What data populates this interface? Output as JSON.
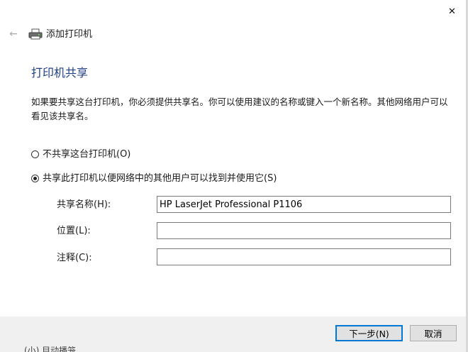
{
  "window": {
    "close_glyph": "✕",
    "back_glyph": "←",
    "wizard_title": "添加打印机",
    "wizard_icon": "printer-icon"
  },
  "page": {
    "title": "打印机共享",
    "description": "如果要共享这台打印机，你必须提供共享名。你可以使用建议的名称或键入一个新名称。其他网络用户可以看见该共享名。"
  },
  "options": {
    "no_share": {
      "label": "不共享这台打印机(O)",
      "checked": false
    },
    "share": {
      "label": "共享此打印机以便网络中的其他用户可以找到并使用它(S)",
      "checked": true
    }
  },
  "fields": {
    "share_name": {
      "label": "共享名称(H):",
      "value": "HP LaserJet Professional P1106"
    },
    "location": {
      "label": "位置(L):",
      "value": ""
    },
    "comment": {
      "label": "注释(C):",
      "value": ""
    }
  },
  "buttons": {
    "next": "下一步(N)",
    "cancel": "取消"
  },
  "background_text": "(小) 目动播笼"
}
